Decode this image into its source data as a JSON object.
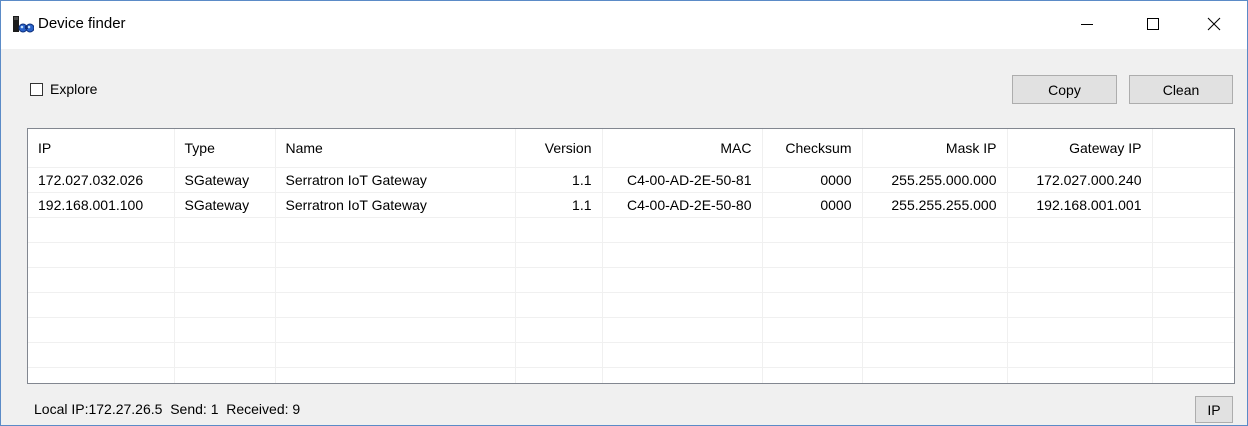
{
  "window": {
    "title": "Device finder",
    "icon": "binoculars-device-icon",
    "controls": {
      "minimize": "minimize-icon",
      "maximize": "maximize-icon",
      "close": "close-icon"
    }
  },
  "toolbar": {
    "explore_label": "Explore",
    "explore_checked": false,
    "copy_label": "Copy",
    "clean_label": "Clean"
  },
  "table": {
    "columns": [
      "IP",
      "Type",
      "Name",
      "Version",
      "MAC",
      "Checksum",
      "Mask IP",
      "Gateway IP"
    ],
    "rows": [
      [
        "172.027.032.026",
        "SGateway",
        "Serratron IoT Gateway",
        "1.1",
        "C4-00-AD-2E-50-81",
        "0000",
        "255.255.000.000",
        "172.027.000.240"
      ],
      [
        "192.168.001.100",
        "SGateway",
        "Serratron IoT Gateway",
        "1.1",
        "C4-00-AD-2E-50-80",
        "0000",
        "255.255.255.000",
        "192.168.001.001"
      ]
    ]
  },
  "status": {
    "text": "Local IP:172.27.26.5  Send: 1  Received: 9",
    "ip_button_label": "IP"
  }
}
